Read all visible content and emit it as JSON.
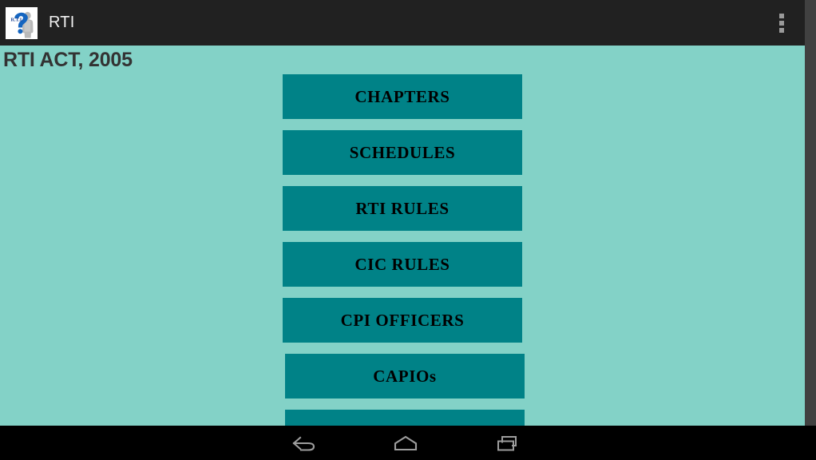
{
  "app": {
    "title": "RTI",
    "icon": "rti-question-mark-icon",
    "overflow_icon": "overflow-menu-icon"
  },
  "content": {
    "page_title": "RTI ACT, 2005",
    "buttons": [
      {
        "label": "CHAPTERS",
        "name": "chapters-button"
      },
      {
        "label": "SCHEDULES",
        "name": "schedules-button"
      },
      {
        "label": "RTI RULES",
        "name": "rti-rules-button"
      },
      {
        "label": "CIC RULES",
        "name": "cic-rules-button"
      },
      {
        "label": "CPI OFFICERS",
        "name": "cpi-officers-button"
      },
      {
        "label": "CAPIOs",
        "name": "capios-button"
      },
      {
        "label": "",
        "name": "partial-button"
      }
    ]
  },
  "navigation": {
    "back_label": "Back",
    "home_label": "Home",
    "recent_label": "Recent apps"
  },
  "colors": {
    "action_bar": "#212121",
    "background": "#83d2c7",
    "button": "#008287",
    "button_text": "#000000",
    "title_text": "#333333",
    "nav_bar": "#000000"
  }
}
